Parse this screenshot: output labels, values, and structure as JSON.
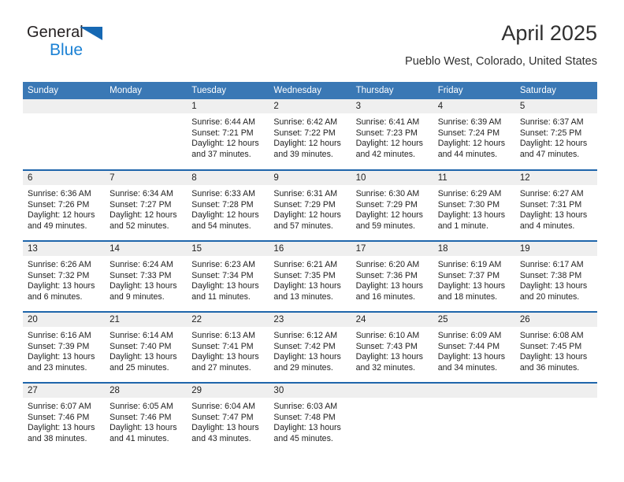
{
  "brand": {
    "name_part1": "General",
    "name_part2": "Blue",
    "triangle_icon": "triangle-icon",
    "accent_color": "#1668b3",
    "blue_text_color": "#1b81d4"
  },
  "header": {
    "title": "April 2025",
    "subtitle": "Pueblo West, Colorado, United States"
  },
  "theme": {
    "header_blue": "#3a78b5",
    "row_divider_blue": "#1f66ab",
    "daynum_band_gray": "#efefef"
  },
  "calendar": {
    "weekdays": [
      "Sunday",
      "Monday",
      "Tuesday",
      "Wednesday",
      "Thursday",
      "Friday",
      "Saturday"
    ],
    "weeks": [
      [
        {
          "day": "",
          "empty": true,
          "sunrise": "",
          "sunset": "",
          "daylight_line1": "",
          "daylight_line2": ""
        },
        {
          "day": "",
          "empty": true,
          "sunrise": "",
          "sunset": "",
          "daylight_line1": "",
          "daylight_line2": ""
        },
        {
          "day": "1",
          "empty": false,
          "sunrise": "Sunrise: 6:44 AM",
          "sunset": "Sunset: 7:21 PM",
          "daylight_line1": "Daylight: 12 hours",
          "daylight_line2": "and 37 minutes."
        },
        {
          "day": "2",
          "empty": false,
          "sunrise": "Sunrise: 6:42 AM",
          "sunset": "Sunset: 7:22 PM",
          "daylight_line1": "Daylight: 12 hours",
          "daylight_line2": "and 39 minutes."
        },
        {
          "day": "3",
          "empty": false,
          "sunrise": "Sunrise: 6:41 AM",
          "sunset": "Sunset: 7:23 PM",
          "daylight_line1": "Daylight: 12 hours",
          "daylight_line2": "and 42 minutes."
        },
        {
          "day": "4",
          "empty": false,
          "sunrise": "Sunrise: 6:39 AM",
          "sunset": "Sunset: 7:24 PM",
          "daylight_line1": "Daylight: 12 hours",
          "daylight_line2": "and 44 minutes."
        },
        {
          "day": "5",
          "empty": false,
          "sunrise": "Sunrise: 6:37 AM",
          "sunset": "Sunset: 7:25 PM",
          "daylight_line1": "Daylight: 12 hours",
          "daylight_line2": "and 47 minutes."
        }
      ],
      [
        {
          "day": "6",
          "empty": false,
          "sunrise": "Sunrise: 6:36 AM",
          "sunset": "Sunset: 7:26 PM",
          "daylight_line1": "Daylight: 12 hours",
          "daylight_line2": "and 49 minutes."
        },
        {
          "day": "7",
          "empty": false,
          "sunrise": "Sunrise: 6:34 AM",
          "sunset": "Sunset: 7:27 PM",
          "daylight_line1": "Daylight: 12 hours",
          "daylight_line2": "and 52 minutes."
        },
        {
          "day": "8",
          "empty": false,
          "sunrise": "Sunrise: 6:33 AM",
          "sunset": "Sunset: 7:28 PM",
          "daylight_line1": "Daylight: 12 hours",
          "daylight_line2": "and 54 minutes."
        },
        {
          "day": "9",
          "empty": false,
          "sunrise": "Sunrise: 6:31 AM",
          "sunset": "Sunset: 7:29 PM",
          "daylight_line1": "Daylight: 12 hours",
          "daylight_line2": "and 57 minutes."
        },
        {
          "day": "10",
          "empty": false,
          "sunrise": "Sunrise: 6:30 AM",
          "sunset": "Sunset: 7:29 PM",
          "daylight_line1": "Daylight: 12 hours",
          "daylight_line2": "and 59 minutes."
        },
        {
          "day": "11",
          "empty": false,
          "sunrise": "Sunrise: 6:29 AM",
          "sunset": "Sunset: 7:30 PM",
          "daylight_line1": "Daylight: 13 hours",
          "daylight_line2": "and 1 minute."
        },
        {
          "day": "12",
          "empty": false,
          "sunrise": "Sunrise: 6:27 AM",
          "sunset": "Sunset: 7:31 PM",
          "daylight_line1": "Daylight: 13 hours",
          "daylight_line2": "and 4 minutes."
        }
      ],
      [
        {
          "day": "13",
          "empty": false,
          "sunrise": "Sunrise: 6:26 AM",
          "sunset": "Sunset: 7:32 PM",
          "daylight_line1": "Daylight: 13 hours",
          "daylight_line2": "and 6 minutes."
        },
        {
          "day": "14",
          "empty": false,
          "sunrise": "Sunrise: 6:24 AM",
          "sunset": "Sunset: 7:33 PM",
          "daylight_line1": "Daylight: 13 hours",
          "daylight_line2": "and 9 minutes."
        },
        {
          "day": "15",
          "empty": false,
          "sunrise": "Sunrise: 6:23 AM",
          "sunset": "Sunset: 7:34 PM",
          "daylight_line1": "Daylight: 13 hours",
          "daylight_line2": "and 11 minutes."
        },
        {
          "day": "16",
          "empty": false,
          "sunrise": "Sunrise: 6:21 AM",
          "sunset": "Sunset: 7:35 PM",
          "daylight_line1": "Daylight: 13 hours",
          "daylight_line2": "and 13 minutes."
        },
        {
          "day": "17",
          "empty": false,
          "sunrise": "Sunrise: 6:20 AM",
          "sunset": "Sunset: 7:36 PM",
          "daylight_line1": "Daylight: 13 hours",
          "daylight_line2": "and 16 minutes."
        },
        {
          "day": "18",
          "empty": false,
          "sunrise": "Sunrise: 6:19 AM",
          "sunset": "Sunset: 7:37 PM",
          "daylight_line1": "Daylight: 13 hours",
          "daylight_line2": "and 18 minutes."
        },
        {
          "day": "19",
          "empty": false,
          "sunrise": "Sunrise: 6:17 AM",
          "sunset": "Sunset: 7:38 PM",
          "daylight_line1": "Daylight: 13 hours",
          "daylight_line2": "and 20 minutes."
        }
      ],
      [
        {
          "day": "20",
          "empty": false,
          "sunrise": "Sunrise: 6:16 AM",
          "sunset": "Sunset: 7:39 PM",
          "daylight_line1": "Daylight: 13 hours",
          "daylight_line2": "and 23 minutes."
        },
        {
          "day": "21",
          "empty": false,
          "sunrise": "Sunrise: 6:14 AM",
          "sunset": "Sunset: 7:40 PM",
          "daylight_line1": "Daylight: 13 hours",
          "daylight_line2": "and 25 minutes."
        },
        {
          "day": "22",
          "empty": false,
          "sunrise": "Sunrise: 6:13 AM",
          "sunset": "Sunset: 7:41 PM",
          "daylight_line1": "Daylight: 13 hours",
          "daylight_line2": "and 27 minutes."
        },
        {
          "day": "23",
          "empty": false,
          "sunrise": "Sunrise: 6:12 AM",
          "sunset": "Sunset: 7:42 PM",
          "daylight_line1": "Daylight: 13 hours",
          "daylight_line2": "and 29 minutes."
        },
        {
          "day": "24",
          "empty": false,
          "sunrise": "Sunrise: 6:10 AM",
          "sunset": "Sunset: 7:43 PM",
          "daylight_line1": "Daylight: 13 hours",
          "daylight_line2": "and 32 minutes."
        },
        {
          "day": "25",
          "empty": false,
          "sunrise": "Sunrise: 6:09 AM",
          "sunset": "Sunset: 7:44 PM",
          "daylight_line1": "Daylight: 13 hours",
          "daylight_line2": "and 34 minutes."
        },
        {
          "day": "26",
          "empty": false,
          "sunrise": "Sunrise: 6:08 AM",
          "sunset": "Sunset: 7:45 PM",
          "daylight_line1": "Daylight: 13 hours",
          "daylight_line2": "and 36 minutes."
        }
      ],
      [
        {
          "day": "27",
          "empty": false,
          "sunrise": "Sunrise: 6:07 AM",
          "sunset": "Sunset: 7:46 PM",
          "daylight_line1": "Daylight: 13 hours",
          "daylight_line2": "and 38 minutes."
        },
        {
          "day": "28",
          "empty": false,
          "sunrise": "Sunrise: 6:05 AM",
          "sunset": "Sunset: 7:46 PM",
          "daylight_line1": "Daylight: 13 hours",
          "daylight_line2": "and 41 minutes."
        },
        {
          "day": "29",
          "empty": false,
          "sunrise": "Sunrise: 6:04 AM",
          "sunset": "Sunset: 7:47 PM",
          "daylight_line1": "Daylight: 13 hours",
          "daylight_line2": "and 43 minutes."
        },
        {
          "day": "30",
          "empty": false,
          "sunrise": "Sunrise: 6:03 AM",
          "sunset": "Sunset: 7:48 PM",
          "daylight_line1": "Daylight: 13 hours",
          "daylight_line2": "and 45 minutes."
        },
        {
          "day": "",
          "empty": true,
          "sunrise": "",
          "sunset": "",
          "daylight_line1": "",
          "daylight_line2": ""
        },
        {
          "day": "",
          "empty": true,
          "sunrise": "",
          "sunset": "",
          "daylight_line1": "",
          "daylight_line2": ""
        },
        {
          "day": "",
          "empty": true,
          "sunrise": "",
          "sunset": "",
          "daylight_line1": "",
          "daylight_line2": ""
        }
      ]
    ]
  }
}
